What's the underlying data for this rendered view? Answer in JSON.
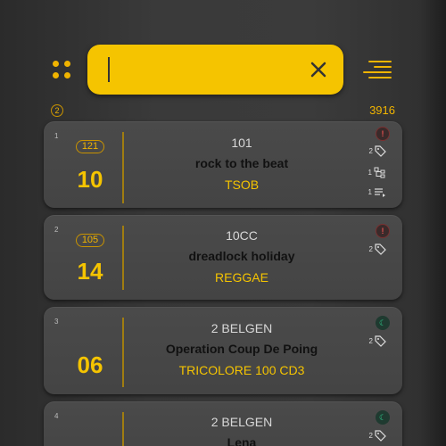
{
  "toolbar": {
    "grid_icon": "grid-dots-icon",
    "menu_icon": "menu-lines-icon",
    "accent_color": "#f5c400"
  },
  "search": {
    "value": "",
    "placeholder": "",
    "clear_icon": "close-icon"
  },
  "summary": {
    "page_badge": "2",
    "total": "3916"
  },
  "tracks": [
    {
      "index": "1",
      "count": "121",
      "number": "10",
      "artist": "101",
      "title": "rock to the beat",
      "label": "TSOB",
      "status": {
        "icon": "info-icon",
        "text": "!",
        "color": "#e05050"
      },
      "meta": {
        "tags": "2",
        "links": "1",
        "playlists": "1"
      }
    },
    {
      "index": "2",
      "count": "105",
      "number": "14",
      "artist": "10CC",
      "title": "dreadlock holiday",
      "label": "REGGAE",
      "status": {
        "icon": "info-icon",
        "text": "!",
        "color": "#e05050"
      },
      "meta": {
        "tags": "2"
      }
    },
    {
      "index": "3",
      "count": "",
      "number": "06",
      "artist": "2 BELGEN",
      "title": "Operation Coup De Poing",
      "label": "TRICOLORE 100 CD3",
      "status": {
        "icon": "moon-icon",
        "text": "☾",
        "color": "#2fc98a"
      },
      "meta": {
        "tags": "2"
      }
    },
    {
      "index": "4",
      "count": "",
      "number": "",
      "artist": "2 BELGEN",
      "title": "Lena",
      "label": "",
      "status": {
        "icon": "moon-icon",
        "text": "☾",
        "color": "#2fc98a"
      },
      "meta": {
        "tags": "2"
      }
    }
  ]
}
